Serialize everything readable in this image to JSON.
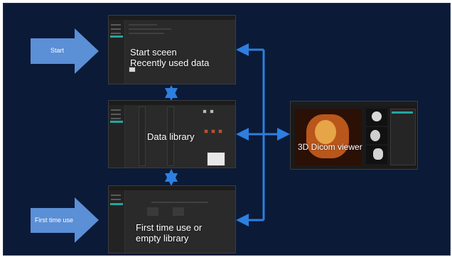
{
  "flow": {
    "start_label": "Start",
    "first_time_label": "First time use",
    "start_screen": {
      "line1": "Start sceen",
      "line2": "Recently used data"
    },
    "data_library": {
      "label": "Data library"
    },
    "first_time_screen": {
      "line1": "First time use or",
      "line2": "empty library"
    },
    "viewer": {
      "label": "3D Dicom viewer"
    }
  },
  "colors": {
    "background": "#0b1a36",
    "big_arrow": "#5b8fd6",
    "connector": "#2d7fe0",
    "app_bg": "#2a2a2a",
    "teal_accent": "#25a5a0"
  }
}
